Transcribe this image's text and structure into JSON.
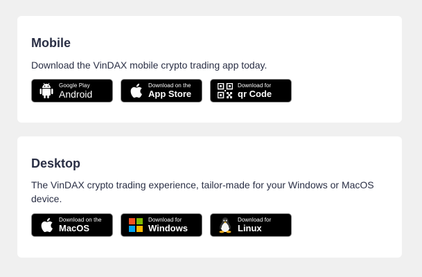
{
  "mobile": {
    "title": "Mobile",
    "description": "Download the VinDAX mobile crypto trading app today.",
    "buttons": [
      {
        "icon": "android-icon",
        "small": "Google Play",
        "big": "Android"
      },
      {
        "icon": "apple-icon",
        "small": "Download on the",
        "big": "App Store"
      },
      {
        "icon": "qr-code-icon",
        "small": "Download for",
        "big": "qr Code"
      }
    ]
  },
  "desktop": {
    "title": "Desktop",
    "description": "The VinDAX crypto trading experience, tailor-made for your Windows or MacOS device.",
    "buttons": [
      {
        "icon": "apple-icon",
        "small": "Download on the",
        "big": "MacOS"
      },
      {
        "icon": "windows-icon",
        "small": "Download for",
        "big": "Windows"
      },
      {
        "icon": "linux-icon",
        "small": "Download for",
        "big": "Linux"
      }
    ]
  },
  "colors": {
    "background": "#f0f0f0",
    "card": "#ffffff",
    "text": "#2a2f45",
    "button": "#000000",
    "windows_red": "#f25022",
    "windows_green": "#7fba00",
    "windows_blue": "#00a4ef",
    "windows_yellow": "#ffb900"
  }
}
